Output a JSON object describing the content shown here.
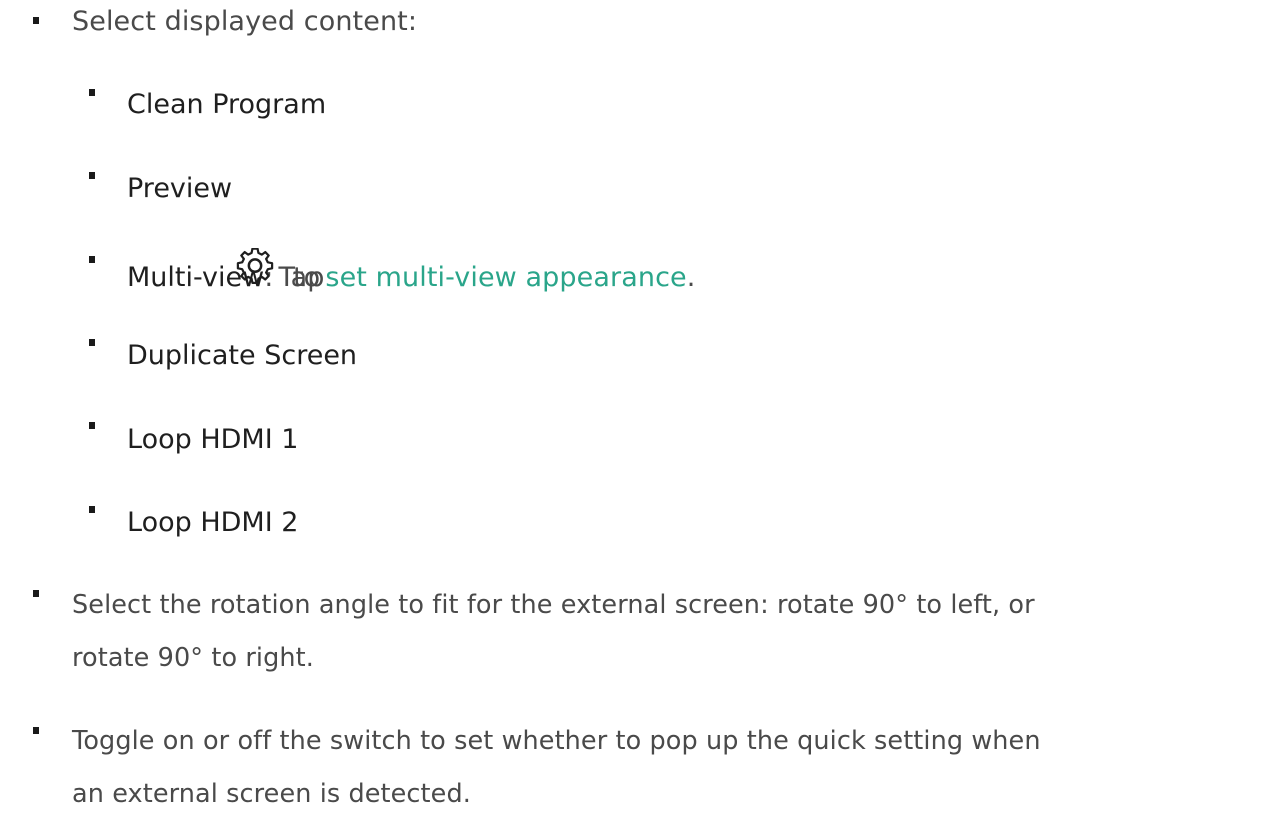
{
  "list": {
    "select_content": "Select displayed content:",
    "options": {
      "clean_program": "Clean Program",
      "preview": "Preview",
      "multiview_label": "Multi-view",
      "multiview_sep": ":",
      "multiview_tap": "Tap",
      "multiview_to": "to",
      "multiview_link": "set multi-view appearance",
      "multiview_end": ".",
      "duplicate_screen": "Duplicate Screen",
      "loop_hdmi_1": "Loop HDMI 1",
      "loop_hdmi_2": "Loop HDMI 2"
    },
    "rotation_line1": "Select the rotation angle to fit for the external screen: rotate 90° to left, or",
    "rotation_line2": "rotate 90° to right.",
    "toggle_line1": "Toggle on or off the switch to set whether to pop up the quick setting when",
    "toggle_line2": "an external screen is detected."
  },
  "icons": {
    "bullet": "square-bullet-icon",
    "settings": "gear-icon"
  },
  "colors": {
    "link": "#2aa58a",
    "text": "#4a4a4a",
    "bold_text": "#1f1f1f"
  }
}
